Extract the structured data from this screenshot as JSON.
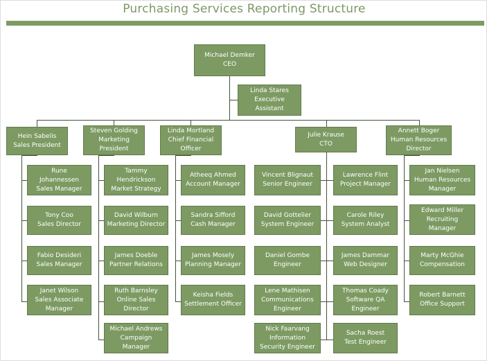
{
  "title": "Purchasing Services Reporting Structure",
  "colors": {
    "node_fill": "#7d9a63",
    "node_border": "#5f7a49",
    "node_text": "#ffffff",
    "title_text": "#7d9766",
    "title_rule": "#7d9a63",
    "connector": "#43533a",
    "background": "#ffffff"
  },
  "org": {
    "ceo": {
      "name": "Michael Demker",
      "role": "CEO"
    },
    "assistant": {
      "name": "Linda Stares",
      "role_line1": "Executive",
      "role_line2": "Assistant"
    },
    "executives": [
      {
        "name": "Hein Sabelis",
        "role": "Sales President"
      },
      {
        "name": "Steven Golding",
        "role_line1": "Marketing",
        "role_line2": "President"
      },
      {
        "name": "Linda Mortland",
        "role_line1": "Chief Financial",
        "role_line2": "Officer"
      },
      {
        "name": "Julie Krause",
        "role": "CTO"
      },
      {
        "name": "Annett Boger",
        "role_line1": "Human Resources",
        "role_line2": "Director"
      }
    ],
    "columns": [
      {
        "parent": "Hein Sabelis",
        "reports": [
          {
            "name_line1": "Rune",
            "name_line2": "Johannessen",
            "role": "Sales Manager"
          },
          {
            "name_line1": "Tony Coo",
            "role": "Sales Director"
          },
          {
            "name_line1": "Fabio Desideri",
            "role": "Sales Manager"
          },
          {
            "name_line1": "Janet Wilson",
            "role_line1": "Sales Associate",
            "role_line2": "Manager"
          }
        ]
      },
      {
        "parent": "Steven Golding",
        "reports": [
          {
            "name_line1": "Tammy",
            "name_line2": "Hendrickson",
            "role": "Market Strategy"
          },
          {
            "name_line1": "David Wilburn",
            "role": "Marketing Director"
          },
          {
            "name_line1": "James Doeble",
            "role": "Partner Relations"
          },
          {
            "name_line1": "Ruth Barnsley",
            "role_line1": "Online Sales",
            "role_line2": "Director"
          },
          {
            "name_line1": "Michael Andrews",
            "role_line1": "Campaign",
            "role_line2": "Manager"
          }
        ]
      },
      {
        "parent": "Linda Mortland",
        "reports": [
          {
            "name_line1": "Atheeq Ahmed",
            "role": "Account Manager"
          },
          {
            "name_line1": "Sandra Sifford",
            "role": "Cash Manager"
          },
          {
            "name_line1": "James Mosely",
            "role": "Planning Manager"
          },
          {
            "name_line1": "Keisha Fields",
            "role": "Settlement Officer"
          }
        ]
      },
      {
        "parent": "Julie Krause",
        "reports": [
          {
            "name_line1": "Vincent Blignaut",
            "role": "Senior Engineer"
          },
          {
            "name_line1": "David Gottelier",
            "role": "System Engineer"
          },
          {
            "name_line1": "Daniel Gombe",
            "role": "Engineer"
          },
          {
            "name_line1": "Lene Mathisen",
            "role_line1": "Communications",
            "role_line2": "Engineer"
          },
          {
            "name_line1": "Nick Faarvang",
            "role_line1": "Information",
            "role_line2": "Security Engineer"
          }
        ]
      },
      {
        "parent": "Julie Krause",
        "reports": [
          {
            "name_line1": "Lawrence Flint",
            "role": "Project Manager"
          },
          {
            "name_line1": "Carole Riley",
            "role": "System Analyst"
          },
          {
            "name_line1": "James Dammar",
            "role": "Web Designer"
          },
          {
            "name_line1": "Thomas Coady",
            "role_line1": "Software QA",
            "role_line2": "Engineer"
          },
          {
            "name_line1": "Sacha Roest",
            "role": "Test Engineer"
          }
        ]
      },
      {
        "parent": "Annett Boger",
        "reports": [
          {
            "name_line1": "Jan Nielsen",
            "role_line1": "Human Resources",
            "role_line2": "Manager"
          },
          {
            "name_line1": "Edward Miller",
            "role_line1": "Recruiting",
            "role_line2": "Manager"
          },
          {
            "name_line1": "Marty McGhie",
            "role": "Compensation"
          },
          {
            "name_line1": "Robert Barnett",
            "role": "Office Support"
          }
        ]
      }
    ]
  }
}
